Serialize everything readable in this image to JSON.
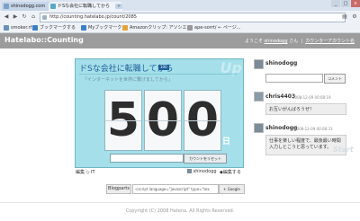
{
  "browser": {
    "tabs": [
      {
        "label": "shinodogg.com"
      },
      {
        "label": "ドSな会社に転職してから"
      }
    ],
    "new_tab_symbol": "+",
    "url": "http://counting.hatelabo.jp/count/2085",
    "window_controls": [
      "_",
      "□",
      "x"
    ],
    "nav": {
      "back": "◀",
      "forward": "▶",
      "reload": "↻",
      "home": "⌂"
    },
    "bookmarks": [
      {
        "label": "smoker.rf"
      },
      {
        "label": "ブックマークする"
      },
      {
        "label": "Myブックマーク"
      },
      {
        "label": "Amazonクリップ: アソシエ..."
      },
      {
        "label": "ape-sorrt/ ← ページ..."
      }
    ]
  },
  "site": {
    "logo": "Hatelabo::Counting",
    "user_greeting": "ようこそ",
    "user_link": "shinodogg",
    "user_suffix": "さん",
    "account_link": "カウンターアカウント名"
  },
  "counter": {
    "title": "ドSな会社に転職してから",
    "badge": "100",
    "watermark": "Up",
    "description": "「インターネットを世界に繋げましてから」",
    "digits": [
      "5",
      "0",
      "0"
    ],
    "unit": "日",
    "reset_button": "カウントをリセット",
    "below_left": "編集  ◇ IT",
    "below_user": "shinodogg",
    "below_right": "◆編集する"
  },
  "embed": {
    "label": "Blogparts",
    "code": "<script language=\"javascript\" type=\"tex",
    "google_button": "+ Google"
  },
  "comments": [
    {
      "user": "shinodogg",
      "time": "",
      "text": ""
    },
    {
      "user": "chris4403",
      "time": "2008-12-09 00:08:19",
      "text": "お互いがんばろうぜ！"
    },
    {
      "user": "shinodogg",
      "time": "2008-12-09 00:08:33",
      "text": "仕事を楽しい程度で、最後最い時間入力しとこうと思っています。"
    }
  ],
  "comment_button": "コメント",
  "start_watermark": "Start",
  "footer": "Copyright (C) 2008 Hatena. All Rights Reserved."
}
